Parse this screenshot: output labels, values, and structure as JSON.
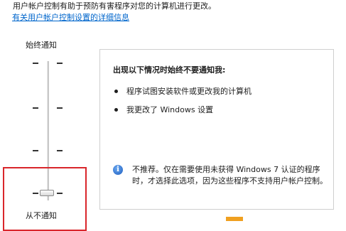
{
  "header": {
    "intro_text": "用户帐户控制有助于预防有害程序对您的计算机进行更改。",
    "learn_more_link": "有关用户帐户控制设置的详细信息"
  },
  "slider": {
    "top_label": "始终通知",
    "bottom_label": "从不通知",
    "selected_level": "从不通知",
    "levels": 4,
    "selected_index": 0
  },
  "panel": {
    "heading": "出现以下情况时始终不要通知我:",
    "bullets": [
      "程序试图安装软件或更改我的计算机",
      "我更改了 Windows 设置"
    ],
    "note_icon": "info-icon",
    "note_text": "不推荐。仅在需要使用未获得 Windows 7 认证的程序时，才选择此选项，因为这些程序不支持用户帐户控制。"
  },
  "colors": {
    "highlight_border": "#d9262b",
    "link": "#0066cc",
    "panel_border": "#cfcfcf"
  }
}
